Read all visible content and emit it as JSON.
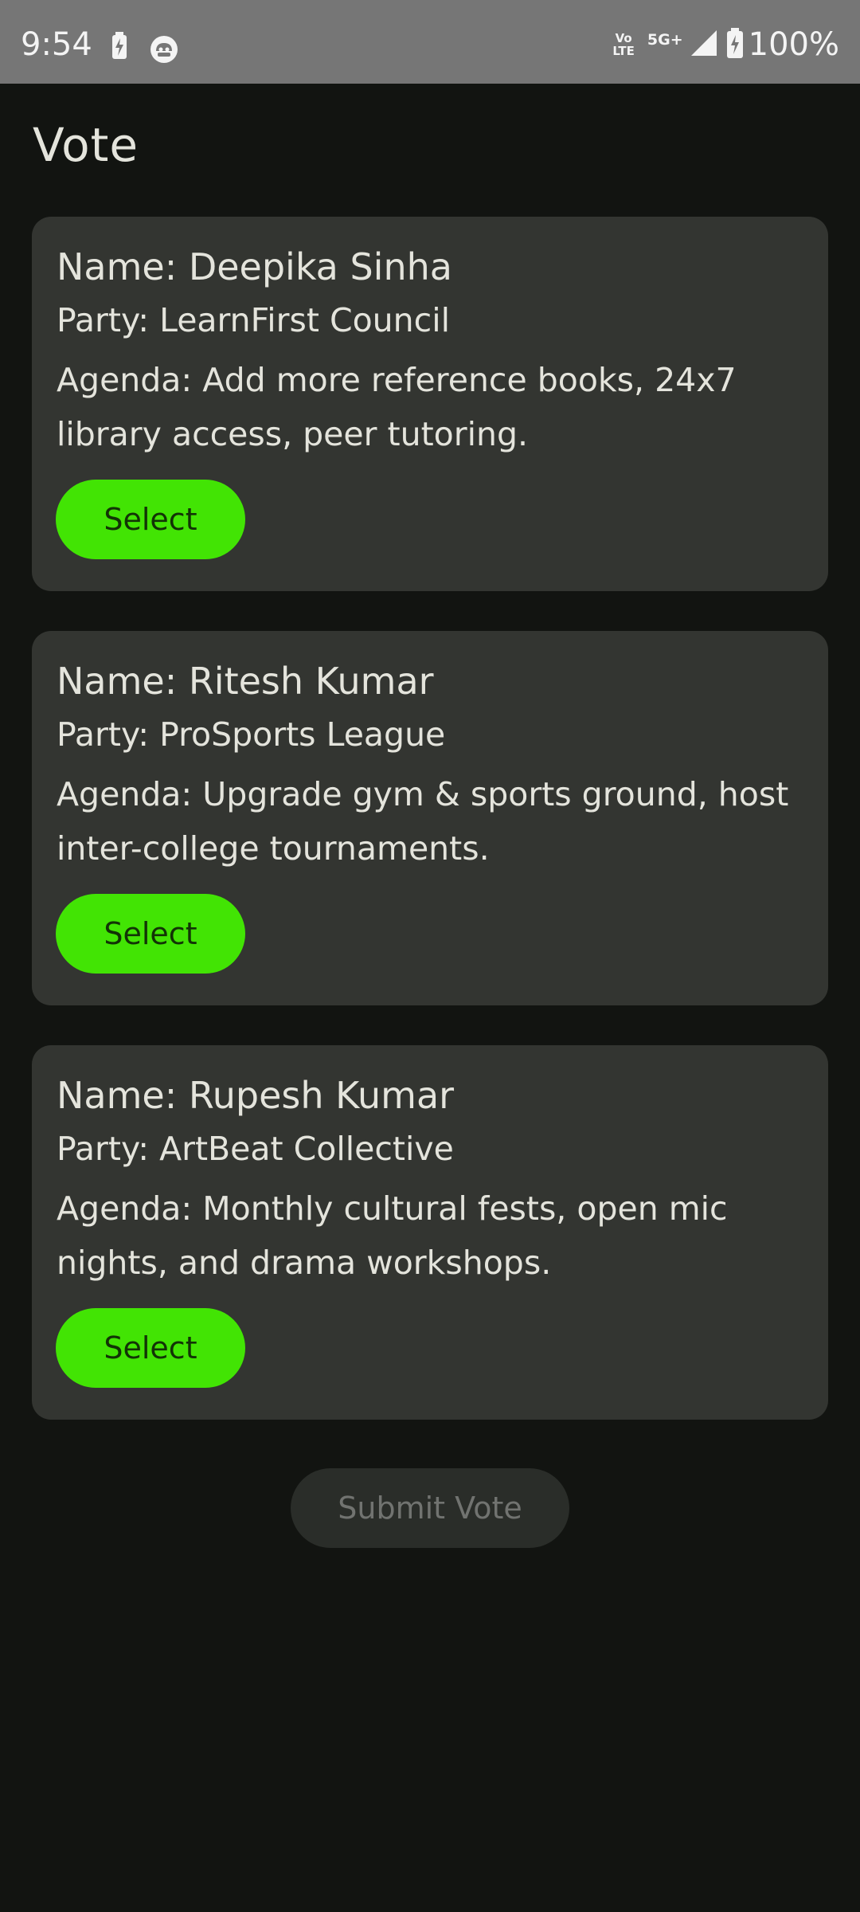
{
  "status_bar": {
    "time": "9:54",
    "network_top": "Vo",
    "network_bottom": "LTE",
    "network_type": "5G+",
    "battery": "100%"
  },
  "page": {
    "title": "Vote"
  },
  "candidates": [
    {
      "name": "Name: Deepika Sinha",
      "party": "Party: LearnFirst Council",
      "agenda": "Agenda: Add more reference books, 24x7 library access, peer tutoring.",
      "select_label": "Select"
    },
    {
      "name": "Name: Ritesh Kumar",
      "party": "Party: ProSports League",
      "agenda": "Agenda: Upgrade gym & sports ground, host inter-college tournaments.",
      "select_label": "Select"
    },
    {
      "name": "Name: Rupesh Kumar",
      "party": "Party: ArtBeat Collective",
      "agenda": "Agenda: Monthly cultural fests, open mic nights, and drama workshops.",
      "select_label": "Select"
    }
  ],
  "submit": {
    "label": "Submit Vote"
  },
  "colors": {
    "background": "#121411",
    "card": "#333531",
    "accent": "#42e404",
    "status_bar": "#767676"
  }
}
